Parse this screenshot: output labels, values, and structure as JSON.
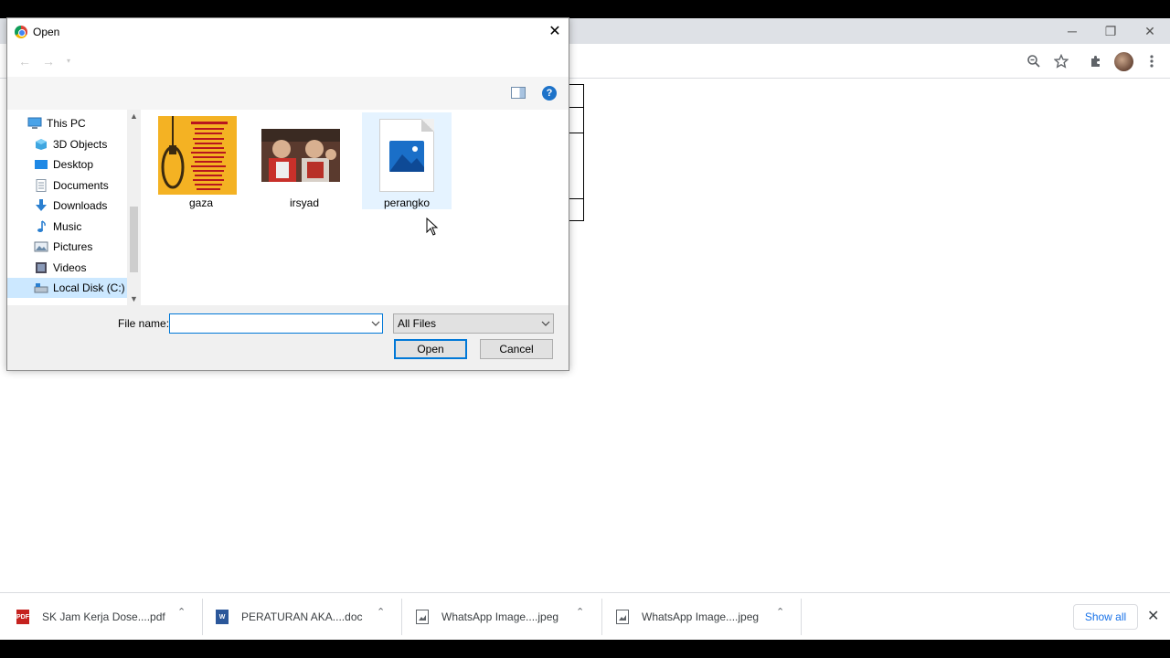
{
  "dialog": {
    "title": "Open",
    "close_glyph": "✕",
    "nav_back": "←",
    "nav_forward": "→",
    "help_glyph": "?"
  },
  "navpane": {
    "items": [
      {
        "label": "This PC",
        "icon": "computer-icon"
      },
      {
        "label": "3D Objects",
        "icon": "cube-icon"
      },
      {
        "label": "Desktop",
        "icon": "desktop-icon"
      },
      {
        "label": "Documents",
        "icon": "document-icon"
      },
      {
        "label": "Downloads",
        "icon": "download-icon"
      },
      {
        "label": "Music",
        "icon": "music-icon"
      },
      {
        "label": "Pictures",
        "icon": "pictures-icon"
      },
      {
        "label": "Videos",
        "icon": "video-icon"
      },
      {
        "label": "Local Disk (C:)",
        "icon": "drive-icon"
      }
    ],
    "selected": "Local Disk (C:)"
  },
  "files": [
    {
      "name": "gaza",
      "type": "image-thumbnail"
    },
    {
      "name": "irsyad",
      "type": "photo-thumbnail"
    },
    {
      "name": "perangko",
      "type": "image-file-icon"
    }
  ],
  "bottom": {
    "filename_label": "File name:",
    "filename_value": "",
    "filter_value": "All Files",
    "open_label": "Open",
    "cancel_label": "Cancel"
  },
  "browser": {
    "minimize": "─",
    "restore": "❐",
    "close": "✕"
  },
  "downloads": {
    "items": [
      {
        "name": "SK Jam Kerja Dose....pdf",
        "icon": "pdf-icon"
      },
      {
        "name": "PERATURAN AKA....doc",
        "icon": "word-doc-icon"
      },
      {
        "name": "WhatsApp Image....jpeg",
        "icon": "image-file-icon"
      },
      {
        "name": "WhatsApp Image....jpeg",
        "icon": "image-file-icon"
      }
    ],
    "show_all": "Show all",
    "close_glyph": "✕"
  },
  "colors": {
    "accent": "#0078d7",
    "selection": "#cce8ff",
    "hover": "#e5f3ff",
    "link": "#1a73e8"
  }
}
